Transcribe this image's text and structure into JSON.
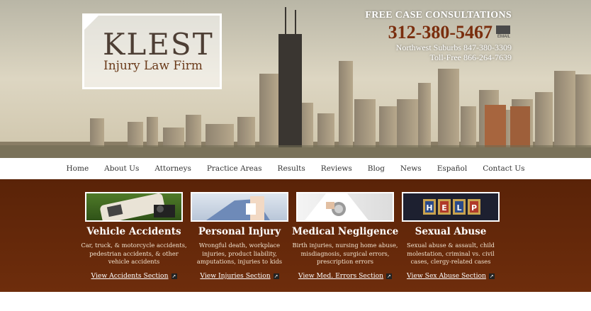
{
  "logo": {
    "name": "KLEST",
    "tagline": "Injury Law Firm"
  },
  "contact": {
    "heading": "FREE CASE CONSULTATIONS",
    "phone": "312-380-5467",
    "email_label": "EMAIL",
    "northwest": "Northwest Suburbs 847-380-3309",
    "tollfree": "Toll-Free 866-264-7639"
  },
  "nav": [
    "Home",
    "About Us",
    "Attorneys",
    "Practice Areas",
    "Results",
    "Reviews",
    "Blog",
    "News",
    "Español",
    "Contact Us"
  ],
  "cards": [
    {
      "title": "Vehicle Accidents",
      "desc": "Car, truck, & motorcycle accidents, pedestrian accidents, & other vehicle accidents",
      "link": "View Accidents Section"
    },
    {
      "title": "Personal Injury",
      "desc": "Wrongful death, workplace injuries, product liability, amputations, injuries to kids",
      "link": "View Injuries Section"
    },
    {
      "title": "Medical Negligence",
      "desc": "Birth injuries, nursing home abuse, misdiagnosis, surgical errors, prescription errors",
      "link": "View Med. Errors Section"
    },
    {
      "title": "Sexual Abuse",
      "desc": "Sexual abuse & assault, child molestation, criminal vs. civil cases, clergy-related cases",
      "link": "View Sex Abuse Section"
    }
  ],
  "help_blocks": [
    "H",
    "E",
    "L",
    "P"
  ],
  "colors": {
    "brown": "#5a2308",
    "phone": "#7a2e0e"
  }
}
